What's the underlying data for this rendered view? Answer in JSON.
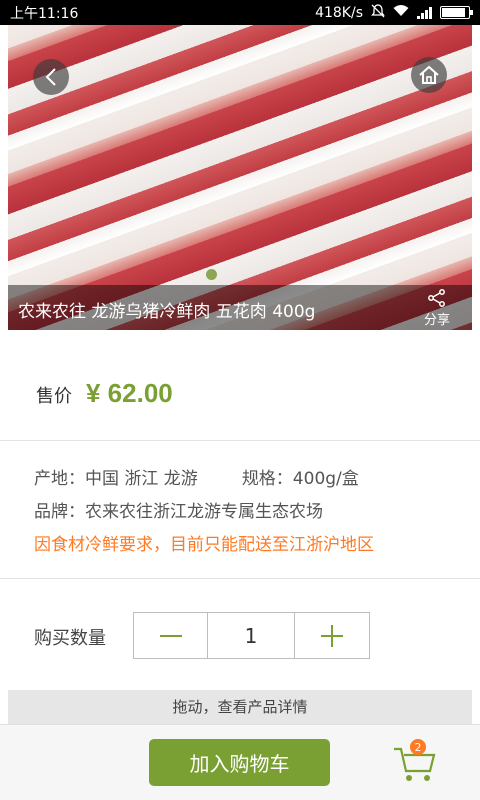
{
  "status_bar": {
    "time": "上午11:16",
    "network_speed": "418K/s",
    "icons": [
      "mute-icon",
      "wifi-icon",
      "signal-icon",
      "battery-icon"
    ],
    "battery_level": 0.9
  },
  "hero": {
    "product_title": "农来农往 龙游乌猪冷鲜肉 五花肉 400g",
    "share_label": "分享",
    "carousel_index": 1,
    "carousel_total": 1
  },
  "price": {
    "label": "售价",
    "value": "¥ 62.00",
    "color": "#7aa033"
  },
  "specs": {
    "origin": "产地：中国 浙江 龙游",
    "spec": "规格：400g/盒",
    "brand": "品牌：农来农往浙江龙游专属生态农场",
    "notice": "因食材冷鲜要求，目前只能配送至江浙沪地区",
    "notice_color": "#ff7a22"
  },
  "quantity": {
    "label": "购买数量",
    "minus": "—",
    "value": "1",
    "plus": "+"
  },
  "drag_hint": "拖动，查看产品详情",
  "bottom_bar": {
    "add_to_cart": "加入购物车",
    "cart_count": "2"
  }
}
